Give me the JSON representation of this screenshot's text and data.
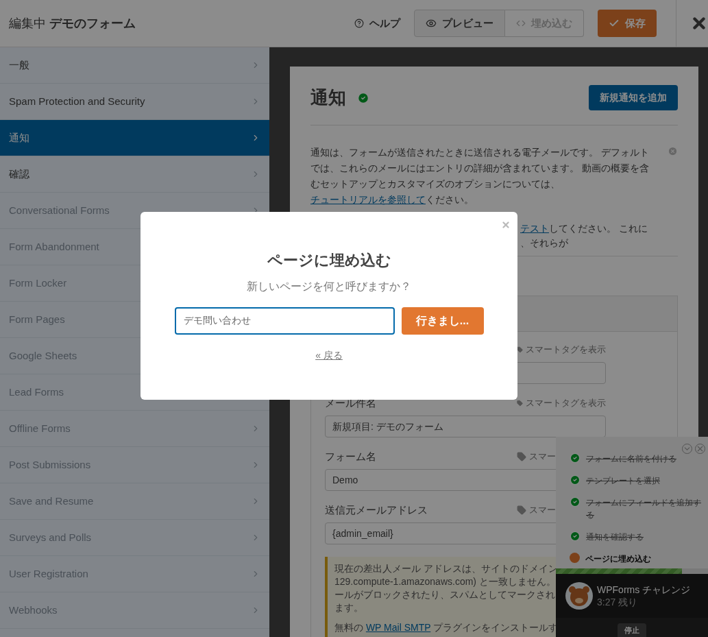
{
  "header": {
    "title": "編集中 **デモのフォーム**",
    "help": "ヘルプ",
    "buttons": [
      {
        "kind": "preview",
        "label": "プレビュー",
        "disabled": false
      },
      {
        "kind": "embed",
        "label": "埋め込む",
        "disabled": true
      },
      {
        "kind": "save",
        "label": "保存",
        "disabled": false
      }
    ]
  },
  "sidebar": {
    "items": [
      {
        "label": "一般",
        "selected": false,
        "disabled": false
      },
      {
        "label": "Spam Protection and Security",
        "selected": false,
        "disabled": false
      },
      {
        "label": "通知",
        "selected": true,
        "disabled": false
      },
      {
        "label": "確認",
        "selected": false,
        "disabled": false
      },
      {
        "label": "Conversational Forms",
        "selected": false,
        "disabled": true
      },
      {
        "label": "Form Abandonment",
        "selected": false,
        "disabled": true
      },
      {
        "label": "Form Locker",
        "selected": false,
        "disabled": true
      },
      {
        "label": "Form Pages",
        "selected": false,
        "disabled": true
      },
      {
        "label": "Google Sheets",
        "selected": false,
        "disabled": true
      },
      {
        "label": "Lead Forms",
        "selected": false,
        "disabled": true
      },
      {
        "label": "Offline Forms",
        "selected": false,
        "disabled": true
      },
      {
        "label": "Post Submissions",
        "selected": false,
        "disabled": true
      },
      {
        "label": "Save and Resume",
        "selected": false,
        "disabled": true
      },
      {
        "label": "Surveys and Polls",
        "selected": false,
        "disabled": true
      },
      {
        "label": "User Registration",
        "selected": false,
        "disabled": true
      },
      {
        "label": "Webhooks",
        "selected": false,
        "disabled": true
      }
    ]
  },
  "panel": {
    "title": "通知",
    "add_button": "新規通知を追加",
    "intro": {
      "text": "通知は、フォームが送信されたときに送信される電子メールです。 デフォルトでは、これらのメールにはエントリの詳細が含まれています。 動画の概要を含むセットアップとカスタマイズのオプションについては、",
      "link": "チュートリアルを参照して",
      "after": "ください。"
    },
    "test_note": {
      "link": "テスト",
      "text": "してください。 これに",
      "line_2": "、それらが"
    },
    "fields": [
      {
        "smart_tag": "スマートタグを表示"
      },
      {
        "label": "メール件名",
        "smart_tag": "スマートタグを表示",
        "value": "新規項目: デモのフォーム"
      },
      {
        "label": "フォーム名",
        "smart_tag": "スマー",
        "value": "Demo"
      },
      {
        "label": "送信元メールアドレス",
        "smart_tag": "スマー",
        "value": "{admin_email}"
      }
    ],
    "warning": {
      "lines": [
        "現在の差出人メール アドレスは、サイトのドメイン",
        "129.compute-1.amazonaws.com) と一致しません。",
        "ールがブロックされたり、スパムとしてマークされ",
        "ます。"
      ],
      "smtp": {
        "before": "無料の ",
        "link": "WP Mail SMTP",
        "after": " プラグインをインストールす"
      }
    }
  },
  "modal": {
    "title": "ページに埋め込む",
    "subtitle": "新しいページを何と呼びますか？",
    "value": "デモ問い合わせ",
    "go": "行きまし...",
    "back": "« 戻る"
  },
  "checklist": {
    "items": [
      {
        "label": "フォームに名前を付ける",
        "done": true
      },
      {
        "label": "テンプレートを選択",
        "done": true
      },
      {
        "label": "フォームにフィールドを追加する",
        "done": true
      },
      {
        "label": "通知を確認する",
        "done": true
      },
      {
        "label": "ページに埋め込む",
        "done": false
      }
    ],
    "level": 0.83,
    "title": "WPForms チャレンジ",
    "timer": "3:27 残り",
    "stop": "停止"
  }
}
